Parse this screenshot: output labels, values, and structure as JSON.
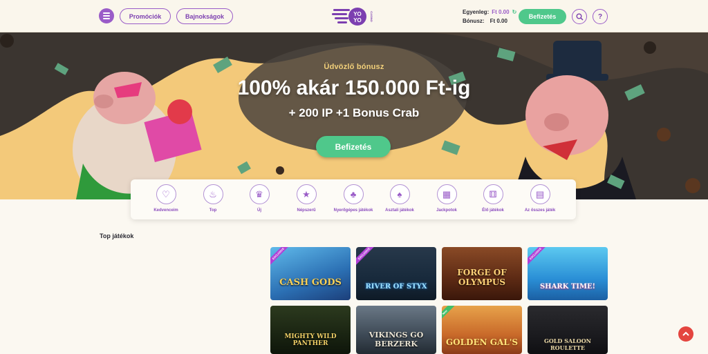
{
  "header": {
    "menu_icon": "hamburger-icon",
    "promotions_label": "Promóciók",
    "tournaments_label": "Bajnokságok",
    "logo_text_top": "YO",
    "logo_text_bottom": "YO",
    "logo_sub": "CASINO",
    "balance_label": "Egyenleg:",
    "balance_value": "Ft 0.00",
    "bonus_label": "Bónusz:",
    "bonus_value": "Ft 0.00",
    "deposit_label": "Befizetés",
    "search_icon": "search-icon",
    "help_label": "?"
  },
  "hero": {
    "subtitle": "Üdvözlő bónusz",
    "headline": "100% akár 150.000 Ft-ig",
    "extra": "+ 200 IP +1 Bonus Crab",
    "cta": "Befizetés"
  },
  "categories": [
    {
      "label": "Kedvenceim",
      "icon": "hearts-icon"
    },
    {
      "label": "Top",
      "icon": "flame-icon"
    },
    {
      "label": "Új",
      "icon": "crown-icon"
    },
    {
      "label": "Népszerű",
      "icon": "star-icon"
    },
    {
      "label": "Nyerőgépes játékok",
      "icon": "cherries-icon"
    },
    {
      "label": "Asztali játékok",
      "icon": "cards-icon"
    },
    {
      "label": "Jackpotok",
      "icon": "slot-reels-icon"
    },
    {
      "label": "Élő játékok",
      "icon": "dice-icon"
    },
    {
      "label": "Az összes játék",
      "icon": "book-icon"
    }
  ],
  "top_games": {
    "title": "Top játékok",
    "games": [
      {
        "name": "CASH GODS",
        "badge": "EXCLUSIVE"
      },
      {
        "name": "RIVER OF STYX",
        "badge": "EXCLUSIVE"
      },
      {
        "name": "FORGE OF OLYMPUS",
        "badge": ""
      },
      {
        "name": "SHARK TIME!",
        "badge": "EXCLUSIVE"
      },
      {
        "name": "MIGHTY WILD PANTHER",
        "badge": ""
      },
      {
        "name": "VIKINGS GO BERZERK",
        "badge": ""
      },
      {
        "name": "GOLDEN GAL'S",
        "badge": "New"
      },
      {
        "name": "GOLD SALOON ROULETTE",
        "badge": ""
      }
    ]
  },
  "colors": {
    "brand_purple": "#9a5cc8",
    "accent_green": "#4fc88b",
    "scroll_top_red": "#e4453f"
  }
}
